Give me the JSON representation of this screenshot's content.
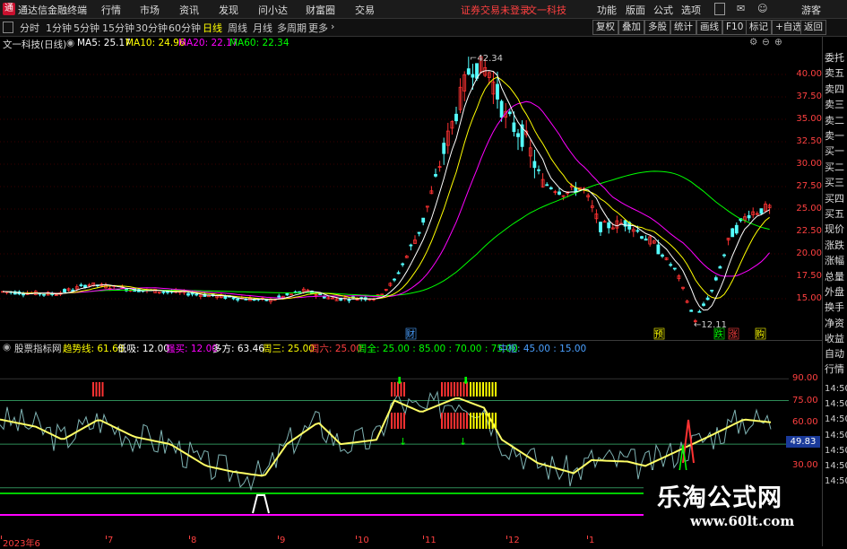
{
  "menubar": {
    "app_title": "通达信金融终端",
    "items": [
      "行情",
      "市场",
      "资讯",
      "发现",
      "问小达",
      "财富圈",
      "交易"
    ],
    "notice": "证券交易未登录",
    "stock": "文一科技",
    "right_items": [
      "功能",
      "版面",
      "公式",
      "选项"
    ],
    "guest": "游客"
  },
  "toolbar": {
    "periods": [
      "分时",
      "1分钟",
      "5分钟",
      "15分钟",
      "30分钟",
      "60分钟",
      "日线",
      "周线",
      "月线",
      "多周期",
      "更多"
    ],
    "active_period": "日线",
    "right_buttons": [
      "复权",
      "叠加",
      "多股",
      "统计",
      "画线",
      "F10",
      "标记",
      "+自选",
      "返回"
    ]
  },
  "main_legend": {
    "title": "文一科技(日线)",
    "ma": [
      {
        "label": "MA5: 25.17",
        "color": "#ffffff"
      },
      {
        "label": "MA10: 24.96",
        "color": "#ffff00"
      },
      {
        "label": "MA20: 22.17",
        "color": "#ff00ff"
      },
      {
        "label": "MA60: 22.34",
        "color": "#00ff00"
      }
    ]
  },
  "price_axis": [
    "40.00",
    "37.50",
    "35.00",
    "32.50",
    "30.00",
    "27.50",
    "25.00",
    "22.50",
    "20.00",
    "17.50",
    "15.00"
  ],
  "annotations": {
    "high": "42.34",
    "low": "12.11"
  },
  "event_markers": [
    {
      "label": "财",
      "color": "#4aa0ff"
    },
    {
      "label": "预",
      "color": "#ffff00"
    },
    {
      "label": "跌",
      "color": "#00ff00"
    },
    {
      "label": "涨",
      "color": "#ff4040"
    },
    {
      "label": "购",
      "color": "#ffff00"
    }
  ],
  "right_panel": [
    "委托",
    "卖五",
    "卖四",
    "卖三",
    "卖二",
    "卖一",
    "买一",
    "买二",
    "买三",
    "买四",
    "买五",
    "现价",
    "涨跌",
    "涨幅",
    "总量",
    "外盘",
    "换手",
    "净资",
    "收益",
    "自动",
    "行情",
    "14:50",
    "14:50",
    "14:50",
    "14:50",
    "14:50",
    "14:50",
    "14:50"
  ],
  "indicator_legend": {
    "name": "股票指标网",
    "items": [
      {
        "label": "趋势线: 61.68",
        "color": "#ffff00"
      },
      {
        "label": "低吸: 12.00",
        "color": "#ffffff"
      },
      {
        "label": "强买: 12.00",
        "color": "#ff00ff"
      },
      {
        "label": "多方: 63.46",
        "color": "#ffffff"
      },
      {
        "label": "周三: 25.00",
        "color": "#ffff00"
      },
      {
        "label": "周六: 25.00",
        "color": "#ff4040"
      },
      {
        "label": "周全: 25.00 : 85.00 : 70.00 : 75.00",
        "color": "#00ff00"
      },
      {
        "label": "中枢: 45.00 : 15.00",
        "color": "#4aa0ff"
      }
    ]
  },
  "indicator_axis": [
    "90.00",
    "75.00",
    "60.00",
    "45.00",
    "30.00"
  ],
  "indicator_value": "49.83",
  "date_axis": [
    "2023年6",
    "7",
    "8",
    "9",
    "10",
    "11",
    "12",
    "1"
  ],
  "watermark": {
    "title": "乐淘公式网",
    "url": "www.60lt.com"
  },
  "colors": {
    "up": "#ff3232",
    "down": "#54ffff",
    "ma5": "#ffffff",
    "ma10": "#ffff00",
    "ma20": "#ff00ff",
    "ma60": "#00ff00"
  }
}
